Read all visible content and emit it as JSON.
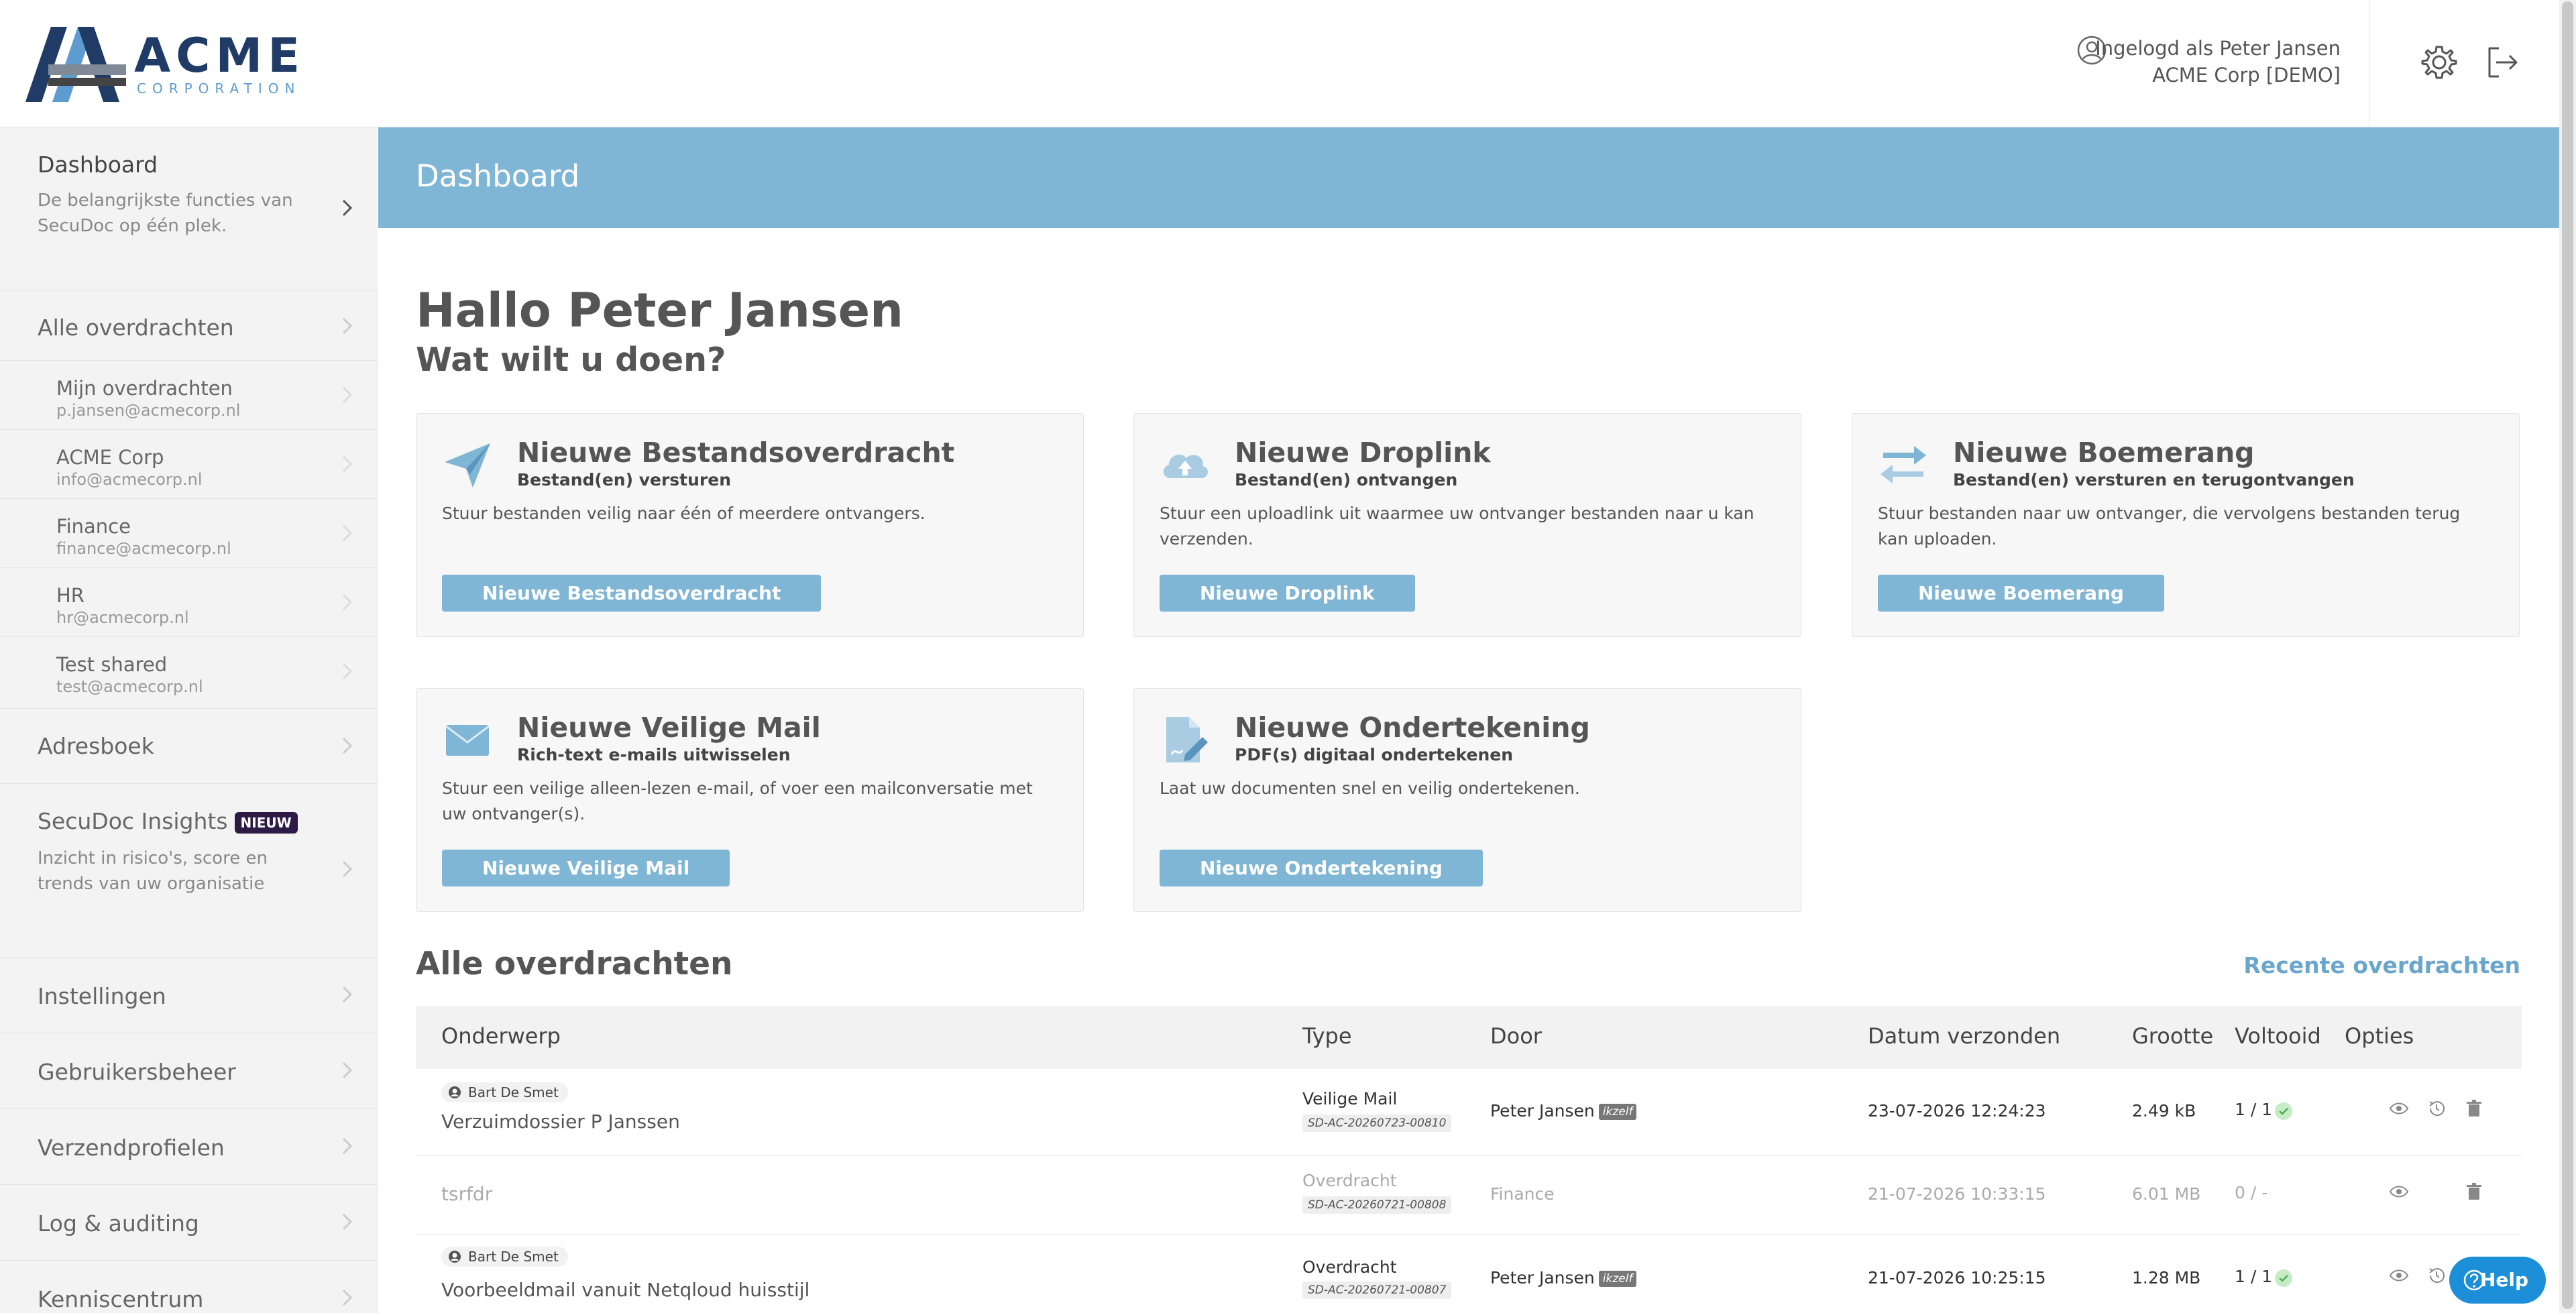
{
  "header": {
    "logo_word": "ACME",
    "logo_sub": "CORPORATION",
    "user_line1": "Ingelogd als Peter Jansen",
    "user_line2": "ACME Corp [DEMO]"
  },
  "sidebar": {
    "dashboard": {
      "title": "Dashboard",
      "desc": "De belangrijkste functies van SecuDoc op één plek."
    },
    "all_transfers": "Alle overdrachten",
    "sub_items": [
      {
        "name": "Mijn overdrachten",
        "email": "p.jansen@acmecorp.nl"
      },
      {
        "name": "ACME Corp",
        "email": "info@acmecorp.nl"
      },
      {
        "name": "Finance",
        "email": "finance@acmecorp.nl"
      },
      {
        "name": "HR",
        "email": "hr@acmecorp.nl"
      },
      {
        "name": "Test shared",
        "email": "test@acmecorp.nl"
      }
    ],
    "addressbook": "Adresboek",
    "insights": {
      "title": "SecuDoc Insights",
      "badge": "NIEUW",
      "desc": "Inzicht in risico's, score en trends van uw organisatie"
    },
    "settings": "Instellingen",
    "user_mgmt": "Gebruikersbeheer",
    "send_profiles": "Verzendprofielen",
    "log": "Log & auditing",
    "knowledge": "Kenniscentrum"
  },
  "main": {
    "banner_title": "Dashboard",
    "greeting": "Hallo Peter Jansen",
    "question": "Wat wilt u doen?",
    "cards": [
      {
        "title": "Nieuwe Bestandsoverdracht",
        "subtitle": "Bestand(en) versturen",
        "desc": "Stuur bestanden veilig naar één of meerdere ontvangers.",
        "button": "Nieuwe Bestandsoverdracht"
      },
      {
        "title": "Nieuwe Droplink",
        "subtitle": "Bestand(en) ontvangen",
        "desc": "Stuur een uploadlink uit waarmee uw ontvanger bestanden naar u kan verzenden.",
        "button": "Nieuwe Droplink"
      },
      {
        "title": "Nieuwe Boemerang",
        "subtitle": "Bestand(en) versturen en terugontvangen",
        "desc": "Stuur bestanden naar uw ontvanger, die vervolgens bestanden terug kan uploaden.",
        "button": "Nieuwe Boemerang"
      },
      {
        "title": "Nieuwe Veilige Mail",
        "subtitle": "Rich-text e-mails uitwisselen",
        "desc": "Stuur een veilige alleen-lezen e-mail, of voer een mailconversatie met uw ontvanger(s).",
        "button": "Nieuwe Veilige Mail"
      },
      {
        "title": "Nieuwe Ondertekening",
        "subtitle": "PDF(s) digitaal ondertekenen",
        "desc": "Laat uw documenten snel en veilig ondertekenen.",
        "button": "Nieuwe Ondertekening"
      }
    ],
    "section_title": "Alle overdrachten",
    "recent_link": "Recente overdrachten"
  },
  "table": {
    "headers": [
      "Onderwerp",
      "Type",
      "Door",
      "Datum verzonden",
      "Grootte",
      "Voltooid",
      "Opties"
    ],
    "rows": [
      {
        "sender": "Bart De Smet",
        "subject": "Verzuimdossier P Janssen",
        "type": "Veilige Mail",
        "id": "SD-AC-20260723-00810",
        "by": "Peter Jansen",
        "self": "ikzelf",
        "date": "23-07-2026 12:24:23",
        "size": "2.49 kB",
        "done": "1 / 1"
      },
      {
        "sender": "",
        "subject": "tsrfdr",
        "type": "Overdracht",
        "id": "SD-AC-20260721-00808",
        "by": "Finance",
        "self": "",
        "date": "21-07-2026 10:33:15",
        "size": "6.01 MB",
        "done": "0 / -"
      },
      {
        "sender": "Bart De Smet",
        "subject": "Voorbeeldmail vanuit Netqloud huisstijl",
        "type": "Overdracht",
        "id": "SD-AC-20260721-00807",
        "by": "Peter Jansen",
        "self": "ikzelf",
        "date": "21-07-2026 10:25:15",
        "size": "1.28 MB",
        "done": "1 / 1"
      }
    ]
  },
  "help": "Help",
  "colors": {
    "banner": "#7fb5d5",
    "button": "#7fb5d5",
    "logo_dark": "#1f3b66",
    "logo_light": "#5d9bd0",
    "help": "#1c8fd8",
    "badge": "#2e1a47"
  }
}
